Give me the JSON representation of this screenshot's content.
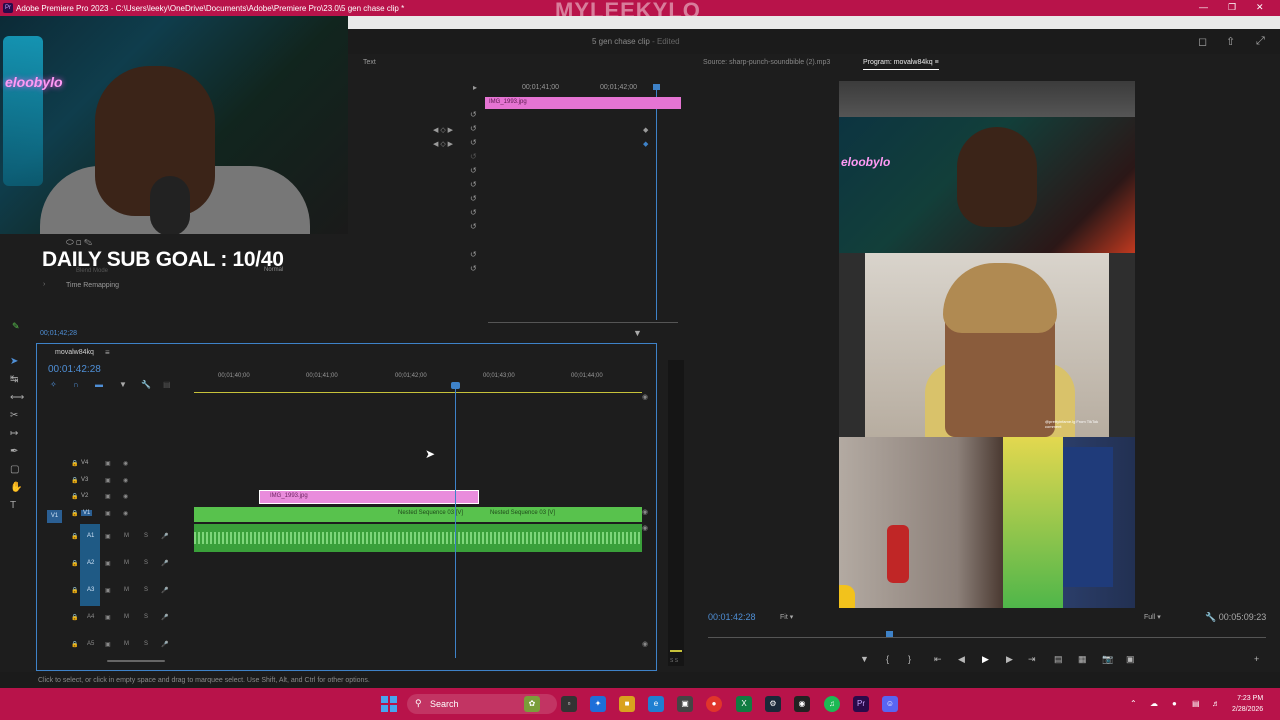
{
  "window": {
    "title": "Adobe Premiere Pro 2023 - C:\\Users\\leeky\\OneDrive\\Documents\\Adobe\\Premiere Pro\\23.0\\5 gen chase clip *",
    "watermark": "MYLEEKYLO",
    "app_badge": "Pr"
  },
  "header": {
    "clip_name": "5 gen chase clip",
    "edited_label": "- Edited"
  },
  "webcam": {
    "neon_sign": "eloobylo"
  },
  "effect_controls": {
    "tab_text": "Text",
    "ruler": [
      "00;01;41;00",
      "00;01;42;00"
    ],
    "clip_label": "IMG_1993.jpg",
    "blend_mode_label": "Blend Mode",
    "blend_mode_value": "Normal",
    "time_remapping": "Time Remapping",
    "current_time": "00;01;42;28"
  },
  "overlay": {
    "sub_goal": "DAILY SUB GOAL : 10/40"
  },
  "timeline": {
    "sequence_name": "movalw84kq",
    "timecode": "00:01:42:28",
    "ruler_ticks": [
      "00;01;40;00",
      "00;01;41;00",
      "00;01;42;00",
      "00;01;43;00",
      "00;01;44;00"
    ],
    "video_tracks": [
      "V4",
      "V3",
      "V2",
      "V1"
    ],
    "audio_tracks": [
      "A1",
      "A2",
      "A3",
      "A4",
      "A5"
    ],
    "clip_image": "IMG_1993.jpg",
    "nested_1": "Nested Sequence 03 [V]",
    "nested_2": "Nested Sequence 03 [V]",
    "track_mute": "M",
    "track_solo": "S"
  },
  "meter": {
    "label": "S S"
  },
  "program_monitor": {
    "source_tab": "Source: sharp-punch-soundbible (2).mp3",
    "program_tab": "Program: movalw84kq",
    "credit": "@prettyinfame.lg From TikTok comment",
    "current_time": "00:01:42:28",
    "fit": "Fit",
    "resolution": "Full",
    "duration": "00:05:09:23"
  },
  "status_bar": {
    "hint": "Click to select, or click in empty space and drag to marquee select. Use Shift, Alt, and Ctrl for other options."
  },
  "taskbar": {
    "search_label": "Search",
    "time": "7:23 PM",
    "date": "2/28/2026"
  },
  "colors": {
    "accent_blue": "#3e82c8",
    "clip_pink": "#e574d3",
    "clip_green": "#58c24d",
    "title_bar": "#b8134a"
  }
}
